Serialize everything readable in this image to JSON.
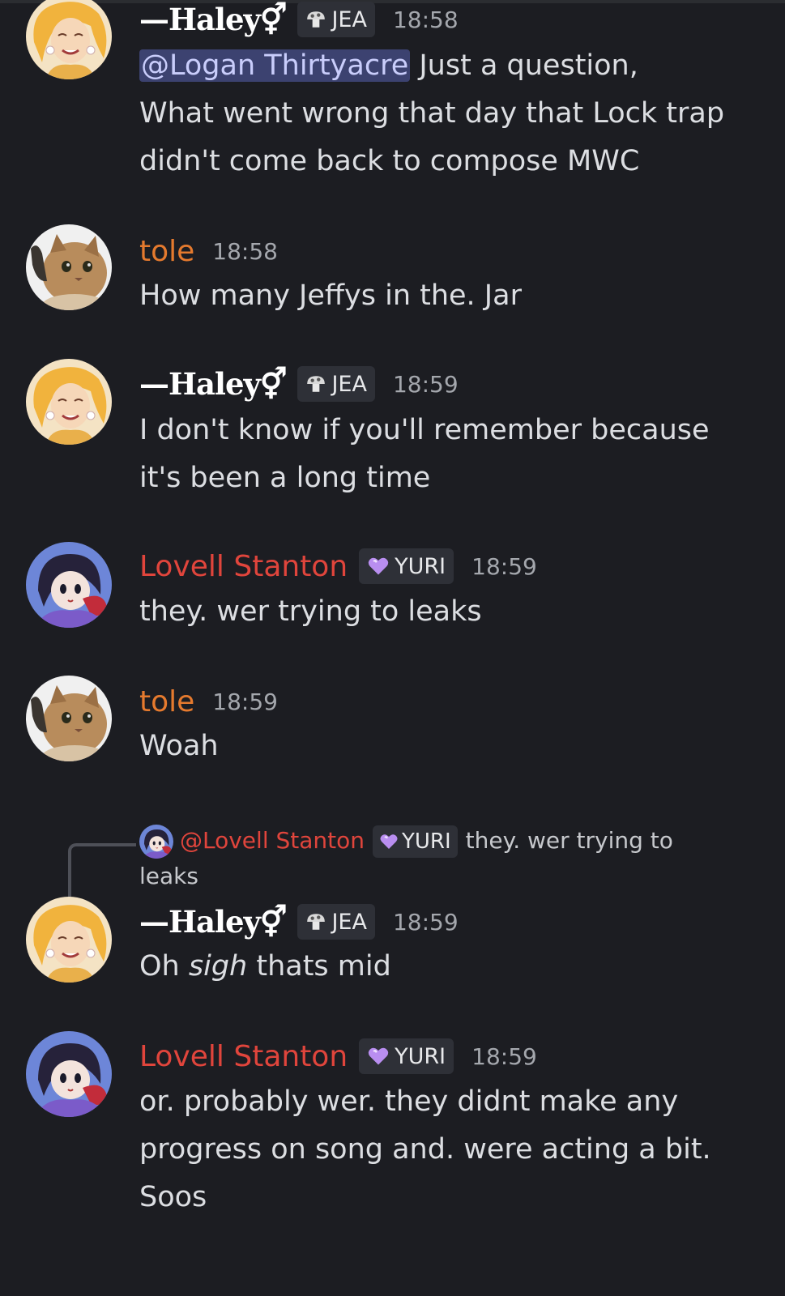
{
  "messages": [
    {
      "author": "—Haley⚥",
      "tag": "JEA",
      "time": "18:58",
      "mention": "@Logan Thirtyacre",
      "text_after_mention": " Just a question,",
      "lines": [
        "What went wrong that day that Lock trap",
        "didn't come back to compose MWC"
      ]
    },
    {
      "author": "tole",
      "time": "18:58",
      "lines": [
        "How many Jeffys in the. Jar"
      ]
    },
    {
      "author": "—Haley⚥",
      "tag": "JEA",
      "time": "18:59",
      "lines": [
        "I don't know if you'll remember because",
        "it's been a long time"
      ]
    },
    {
      "author": "Lovell Stanton",
      "tag": "YURI",
      "time": "18:59",
      "lines": [
        "they. wer trying to leaks"
      ]
    },
    {
      "author": "tole",
      "time": "18:59",
      "lines": [
        "Woah"
      ]
    },
    {
      "reply": {
        "author": "@Lovell Stanton",
        "tag": "YURI",
        "text": "they. wer trying to",
        "text_cont": "leaks"
      },
      "author": "—Haley⚥",
      "tag": "JEA",
      "time": "18:59",
      "text_prefix": "Oh ",
      "text_em": "sigh",
      "text_suffix": " thats mid"
    },
    {
      "author": "Lovell Stanton",
      "tag": "YURI",
      "time": "18:59",
      "lines": [
        "or. probably wer. they didnt make any",
        "progress on song and. were acting a bit.",
        "Soos"
      ]
    }
  ],
  "colors": {
    "background": "#1c1d22",
    "tole_name": "#e57a2e",
    "lovell_name": "#e0453c",
    "mention_bg": "#3c4270"
  },
  "icons": {
    "jea_tag": "mushroom-icon",
    "yuri_tag": "purple-heart-icon"
  }
}
